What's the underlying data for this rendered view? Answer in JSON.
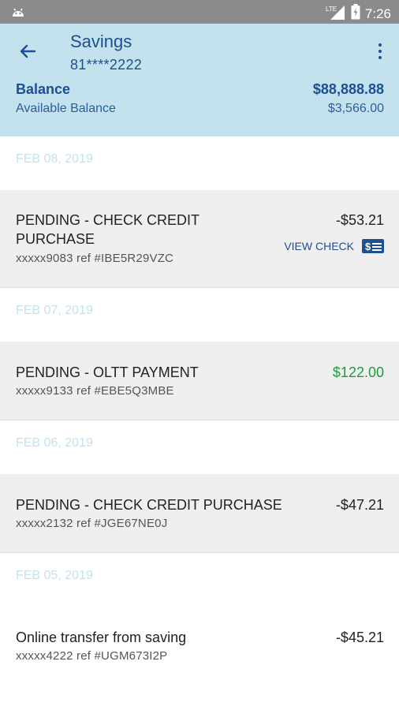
{
  "status_bar": {
    "time": "7:26",
    "network": "LTE"
  },
  "header": {
    "title": "Savings",
    "account_number": "81****2222",
    "balance_label": "Balance",
    "balance_value": "$88,888.88",
    "available_label": "Available Balance",
    "available_value": "$3,566.00"
  },
  "transactions": [
    {
      "date": "FEB 08, 2019",
      "description": "PENDING - CHECK CREDIT PURCHASE",
      "ref": "xxxxx9083 ref #IBE5R29VZC",
      "amount": "-$53.21",
      "action": "VIEW CHECK"
    },
    {
      "date": "FEB 07, 2019",
      "description": "PENDING - OLTT PAYMENT",
      "ref": "xxxxx9133 ref #EBE5Q3MBE",
      "amount": "$122.00"
    },
    {
      "date": "FEB 06, 2019",
      "description": "PENDING - CHECK CREDIT PURCHASE",
      "ref": "xxxxx2132 ref #JGE67NE0J",
      "amount": "-$47.21"
    },
    {
      "date": "FEB 05, 2019",
      "description": "Online transfer from saving",
      "ref": "xxxxx4222 ref #UGM673I2P",
      "amount": "-$45.21"
    }
  ],
  "colors": {
    "header_bg": "#c3e2ee",
    "primary": "#1c4f93",
    "positive": "#1f9d3b",
    "date_text": "#c3e2ee"
  }
}
